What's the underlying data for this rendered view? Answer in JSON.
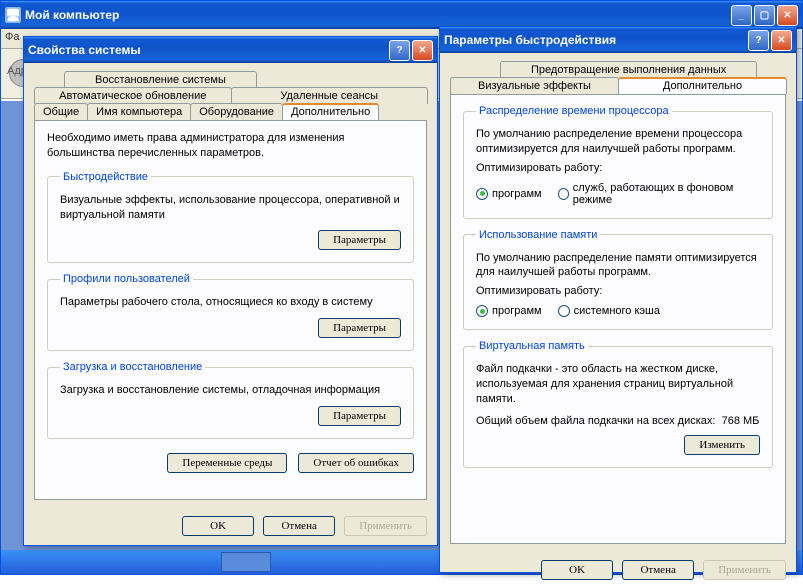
{
  "mainWindow": {
    "title": "Мой компьютер",
    "menubar_frag": "Фа",
    "addr_label": "Адр"
  },
  "dialog1": {
    "title": "Свойства системы",
    "tabs": {
      "restore": "Восстановление системы",
      "auto_update": "Автоматическое обновление",
      "remote": "Удаленные сеансы",
      "general": "Общие",
      "computer_name": "Имя компьютера",
      "hardware": "Оборудование",
      "advanced": "Дополнительно"
    },
    "intro": "Необходимо иметь права администратора для изменения большинства перечисленных параметров.",
    "perf": {
      "legend": "Быстродействие",
      "desc": "Визуальные эффекты, использование процессора, оперативной и виртуальной памяти",
      "button": "Параметры"
    },
    "profiles": {
      "legend": "Профили пользователей",
      "desc": "Параметры рабочего стола, относящиеся ко входу в систему",
      "button": "Параметры"
    },
    "startup": {
      "legend": "Загрузка и восстановление",
      "desc": "Загрузка и восстановление системы, отладочная информация",
      "button": "Параметры"
    },
    "env_button": "Переменные среды",
    "error_button": "Отчет об ошибках",
    "ok": "OK",
    "cancel": "Отмена",
    "apply": "Применить"
  },
  "dialog2": {
    "title": "Параметры быстродействия",
    "tabs": {
      "dep": "Предотвращение выполнения данных",
      "visual": "Визуальные эффекты",
      "advanced": "Дополнительно"
    },
    "cpu": {
      "legend": "Распределение времени процессора",
      "desc": "По умолчанию распределение времени процессора оптимизируется для наилучшей работы программ.",
      "optimize": "Оптимизировать работу:",
      "opt_programs": "программ",
      "opt_services": "служб, работающих в фоновом режиме"
    },
    "mem": {
      "legend": "Использование памяти",
      "desc": "По умолчанию распределение памяти оптимизируется для наилучшей работы программ.",
      "optimize": "Оптимизировать работу:",
      "opt_programs": "программ",
      "opt_cache": "системного кэша"
    },
    "vm": {
      "legend": "Виртуальная память",
      "desc": "Файл подкачки - это область на жестком диске, используемая для хранения страниц виртуальной памяти.",
      "total_label": "Общий объем файла подкачки на всех дисках:",
      "total_value": "768 МБ",
      "change": "Изменить"
    },
    "ok": "OK",
    "cancel": "Отмена",
    "apply": "Применить"
  }
}
